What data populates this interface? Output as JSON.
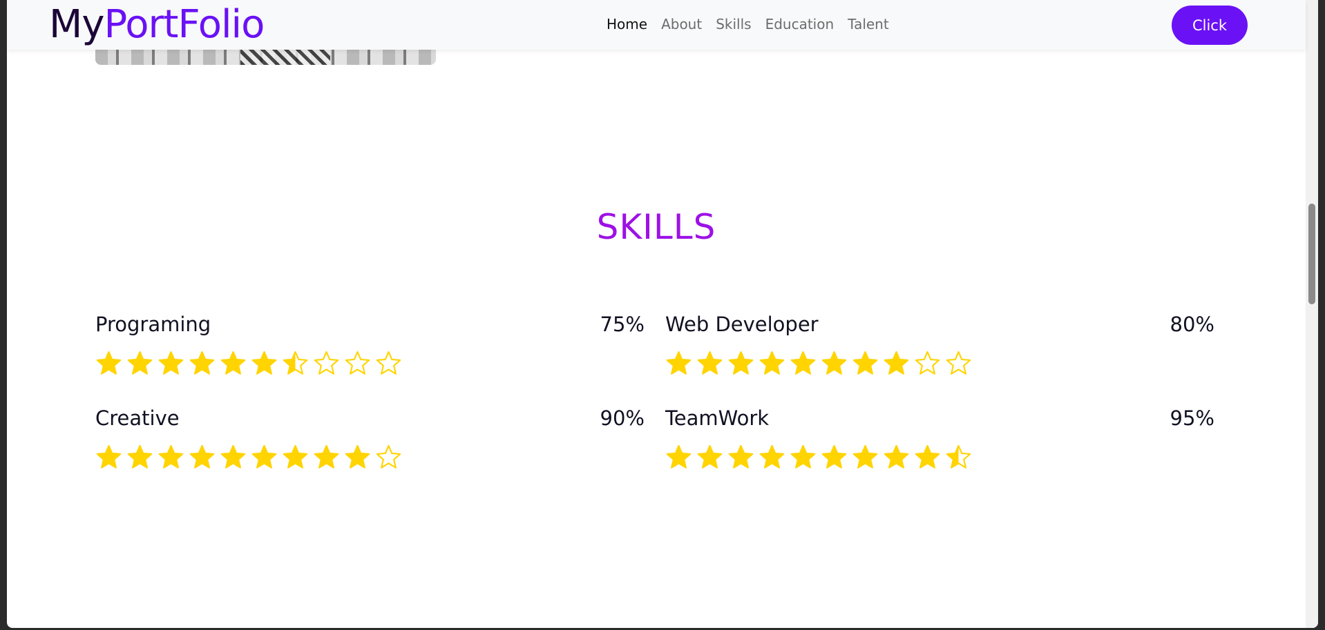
{
  "brand": {
    "part1": "My",
    "part2": "PortFolio"
  },
  "nav": {
    "links": [
      "Home",
      "About",
      "Skills",
      "Education",
      "Talent"
    ],
    "active": "Home",
    "button_label": "Click"
  },
  "skills": {
    "title": "SKILLS",
    "star_color": "#ffd400",
    "accent_color": "#6a11f5",
    "items": [
      {
        "name": "Programing",
        "percent": "75%",
        "rating": 6.5
      },
      {
        "name": "Web Developer",
        "percent": "80%",
        "rating": 8
      },
      {
        "name": "Creative",
        "percent": "90%",
        "rating": 9
      },
      {
        "name": "TeamWork",
        "percent": "95%",
        "rating": 9.5
      }
    ],
    "max_stars": 10
  }
}
